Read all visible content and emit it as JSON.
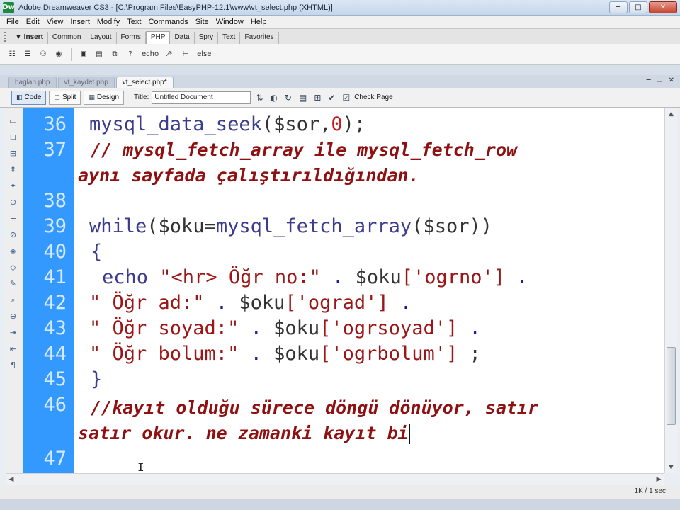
{
  "window": {
    "title": "Adobe Dreamweaver CS3 - [C:\\Program Files\\EasyPHP-12.1\\www\\vt_select.php (XHTML)]",
    "app_icon": "Dw",
    "minimize_glyph": "─",
    "maximize_glyph": "□",
    "close_glyph": "✕"
  },
  "menu": [
    "File",
    "Edit",
    "View",
    "Insert",
    "Modify",
    "Text",
    "Commands",
    "Site",
    "Window",
    "Help"
  ],
  "insert_bar": {
    "label": "▼ Insert",
    "tabs": [
      "Common",
      "Layout",
      "Forms",
      "PHP",
      "Data",
      "Spry",
      "Text",
      "Favorites"
    ],
    "active_tab": "PHP"
  },
  "php_toolbar": {
    "icons": [
      "form-vars-icon",
      "url-vars-icon",
      "session-vars-icon",
      "cookie-vars-icon",
      "include-icon",
      "require-icon",
      "code-block-icon",
      "echo-icon",
      "comment-icon",
      "if-icon",
      "else-icon"
    ],
    "labels": {
      "if": "?",
      "echo": "echo",
      "else": "else"
    }
  },
  "doc_tabs": [
    "baglan.php",
    "vt_kaydet.php",
    "vt_select.php*"
  ],
  "active_doc": "vt_select.php*",
  "doc_toolbar": {
    "code": "Code",
    "split": "Split",
    "design": "Design",
    "title_label": "Title:",
    "title_value": "Untitled Document",
    "check_page": "Check Page"
  },
  "editor": {
    "line_numbers": [
      "36",
      "37",
      "",
      "38",
      "39",
      "40",
      "41",
      "42",
      "43",
      "44",
      "45",
      "46",
      "",
      "47"
    ],
    "line_36": {
      "fn": "mysql_data_seek",
      "args": "($sor,",
      "num": "0",
      "end": ");"
    },
    "line_37a": "// mysql_fetch_array ile mysql_fetch_row",
    "line_37b": "aynı sayfada çalıştırıldığından.",
    "line_39": {
      "kw": "while",
      "open": "(",
      "var": "$oku",
      "eq": "=",
      "fn": "mysql_fetch_array",
      "args": "($sor))"
    },
    "line_40": "{",
    "line_41": {
      "kw": "echo",
      "str": "\"<hr> Öğr no:\"",
      "dot": ".",
      "var": "$oku",
      "key": "['ogrno']",
      "dot2": "."
    },
    "line_42": {
      "str": "\" Öğr ad:\"",
      "dot": ".",
      "var": "$oku",
      "key": "['ograd']",
      "dot2": "."
    },
    "line_43": {
      "str": "\" Öğr soyad:\"",
      "dot": ".",
      "var": "$oku",
      "key": "['ogrsoyad']",
      "dot2": "."
    },
    "line_44": {
      "str": "\" Öğr bolum:\"",
      "dot": ".",
      "var": "$oku",
      "key": "['ogrbolum']",
      "end": ";"
    },
    "line_45": "}",
    "line_46a": "//kayıt olduğu sürece döngü dönüyor, satır",
    "line_46b": "satır okur. ne zamanki kayıt bi",
    "cursor_glyph": "I"
  },
  "status": {
    "text": "1K / 1 sec"
  },
  "colors": {
    "gutter": "#3399ff",
    "comment": "#8e1010",
    "string": "#9b1616",
    "function": "#3c3c8e"
  }
}
